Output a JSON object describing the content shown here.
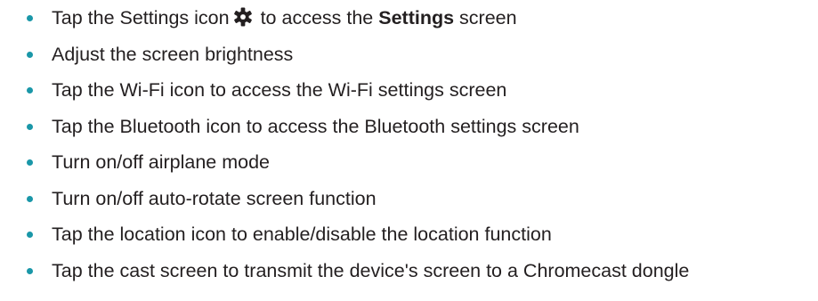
{
  "colors": {
    "bullet": "#1a97a8",
    "text": "#231f20"
  },
  "items": [
    {
      "pre": "Tap the Settings icon",
      "icon": "gear-icon",
      "mid": " to access the ",
      "bold": "Settings",
      "post": " screen"
    },
    {
      "text": "Adjust the screen brightness"
    },
    {
      "text": "Tap the Wi-Fi icon to access the Wi-Fi settings screen"
    },
    {
      "text": "Tap the Bluetooth icon to access the Bluetooth settings screen"
    },
    {
      "text": "Turn on/off airplane mode"
    },
    {
      "text": "Turn on/off auto-rotate screen function"
    },
    {
      "text": "Tap the location icon to enable/disable the location function"
    },
    {
      "text": "Tap the cast screen to transmit the device's screen to a Chromecast dongle"
    }
  ]
}
